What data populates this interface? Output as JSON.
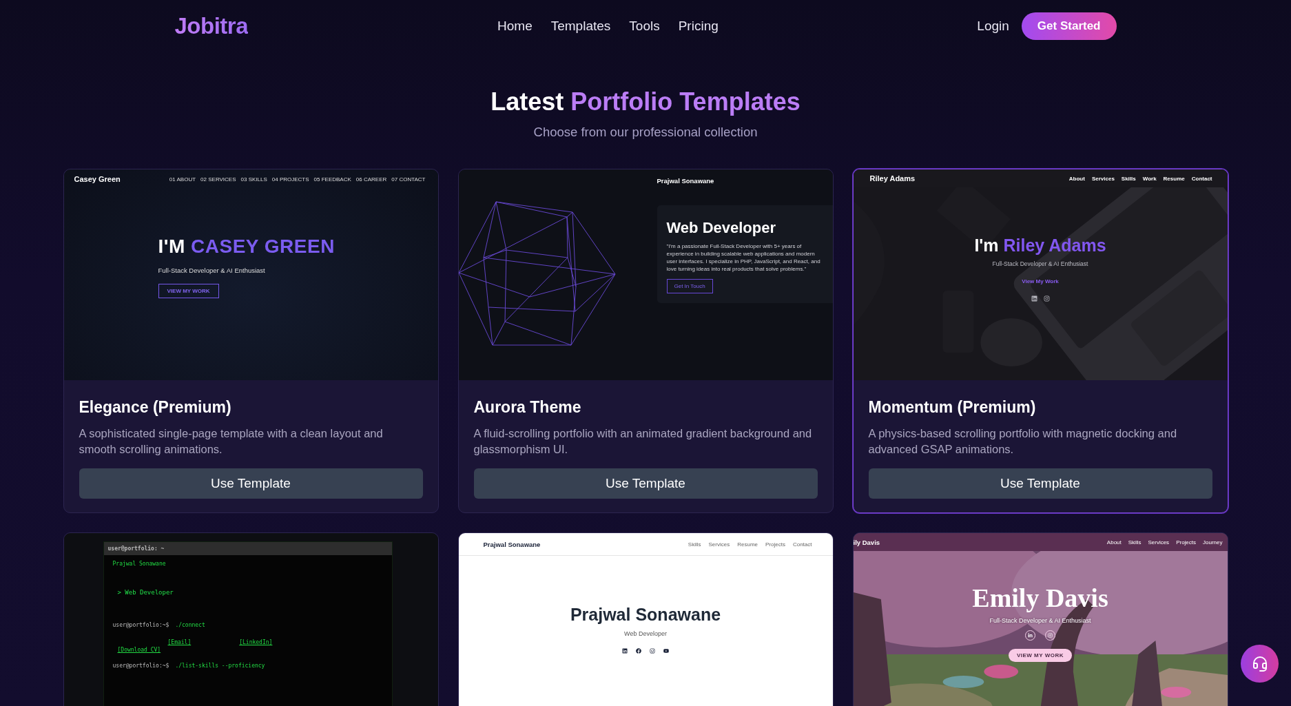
{
  "header": {
    "logo": "Jobitra",
    "nav": [
      "Home",
      "Templates",
      "Tools",
      "Pricing"
    ],
    "login": "Login",
    "cta": "Get Started"
  },
  "hero": {
    "title_lead": "Latest",
    "title_accent": "Portfolio Templates",
    "subtitle": "Choose from our professional collection"
  },
  "templates": [
    {
      "name": "Elegance (Premium)",
      "description": "A sophisticated single-page template with a clean layout and smooth scrolling animations.",
      "button": "Use Template",
      "highlighted": false,
      "preview": {
        "kind": "elegance",
        "brand": "Casey Green",
        "nav": [
          "01 ABOUT",
          "02 SERVICES",
          "03 SKILLS",
          "04 PROJECTS",
          "05 FEEDBACK",
          "06 CAREER",
          "07 CONTACT"
        ],
        "lead": "I'M",
        "name": "CASEY GREEN",
        "tagline": "Full-Stack Developer & AI Enthusiast",
        "button": "VIEW MY WORK"
      }
    },
    {
      "name": "Aurora Theme",
      "description": "A fluid-scrolling portfolio with an animated gradient background and glassmorphism UI.",
      "button": "Use Template",
      "highlighted": false,
      "preview": {
        "kind": "aurora",
        "brand": "Prajwal Sonawane",
        "title": "Web Developer",
        "text": "\"I'm a passionate Full-Stack Developer with 5+ years of experience in building scalable web applications and modern user interfaces. I specialize in PHP, JavaScript, and React, and love turning ideas into real products that solve problems.\"",
        "button": "Get In Touch"
      }
    },
    {
      "name": "Momentum (Premium)",
      "description": "A physics-based scrolling portfolio with magnetic docking and advanced GSAP animations.",
      "button": "Use Template",
      "highlighted": true,
      "preview": {
        "kind": "momentum",
        "brand": "Riley Adams",
        "nav": [
          "About",
          "Services",
          "Skills",
          "Work",
          "Resume",
          "Contact"
        ],
        "lead": "I'm",
        "name": "Riley Adams",
        "tagline": "Full-Stack Developer & AI Enthusiast",
        "link": "View My Work"
      }
    },
    {
      "highlighted": false,
      "preview": {
        "kind": "terminal",
        "window_title": "user@portfolio: ~",
        "name": "Prajwal Sonawane",
        "role": "> Web Developer",
        "command_1": {
          "prompt": "user@portfolio:~$",
          "command": "./connect"
        },
        "links": [
          "[Email]",
          "[LinkedIn]",
          "[Download CV]"
        ],
        "command_2": {
          "prompt": "user@portfolio:~$",
          "command": "./list-skills --proficiency"
        }
      }
    },
    {
      "highlighted": false,
      "preview": {
        "kind": "minimal",
        "brand": "Prajwal Sonawane",
        "nav": [
          "Skills",
          "Services",
          "Resume",
          "Projects",
          "Contact"
        ],
        "name": "Prajwal Sonawane",
        "role": "Web Developer"
      }
    },
    {
      "highlighted": false,
      "preview": {
        "kind": "sakura",
        "brand": "ily Davis",
        "nav": [
          "About",
          "Skills",
          "Services",
          "Projects",
          "Journey"
        ],
        "name": "Emily Davis",
        "tagline": "Full-Stack Developer & AI Enthusiast",
        "button": "VIEW MY WORK"
      }
    }
  ]
}
